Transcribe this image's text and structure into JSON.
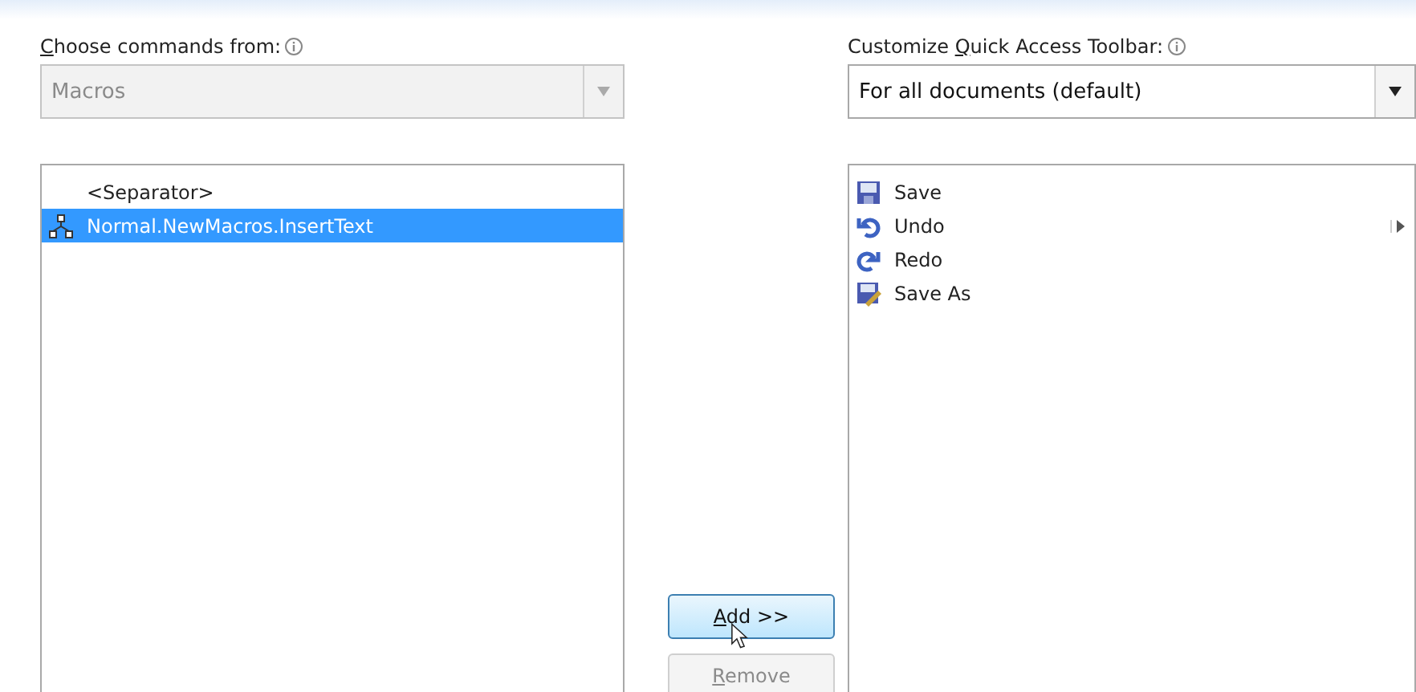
{
  "left": {
    "label": {
      "key": "C",
      "after": "hoose commands from:"
    },
    "combo": {
      "value": "Macros",
      "disabled": true
    },
    "items": [
      {
        "kind": "separator",
        "label": "<Separator>",
        "selected": false
      },
      {
        "kind": "macro",
        "label": "Normal.NewMacros.InsertText",
        "selected": true
      }
    ]
  },
  "buttons": [
    {
      "key": "A",
      "after": "dd >>",
      "disabled": false
    },
    {
      "key": "R",
      "after": "emove",
      "disabled": true
    }
  ],
  "right": {
    "label": {
      "before": "Customize ",
      "key": "Q",
      "after": "uick Access Toolbar:"
    },
    "combo": {
      "value": "For all documents (default)",
      "disabled": false
    },
    "items": [
      {
        "kind": "save",
        "label": "Save",
        "selected": false,
        "has_submenu": false
      },
      {
        "kind": "undo",
        "label": "Undo",
        "selected": false,
        "has_submenu": true
      },
      {
        "kind": "redo",
        "label": "Redo",
        "selected": false,
        "has_submenu": false
      },
      {
        "kind": "save_as",
        "label": "Save As",
        "selected": false,
        "has_submenu": false
      }
    ]
  }
}
